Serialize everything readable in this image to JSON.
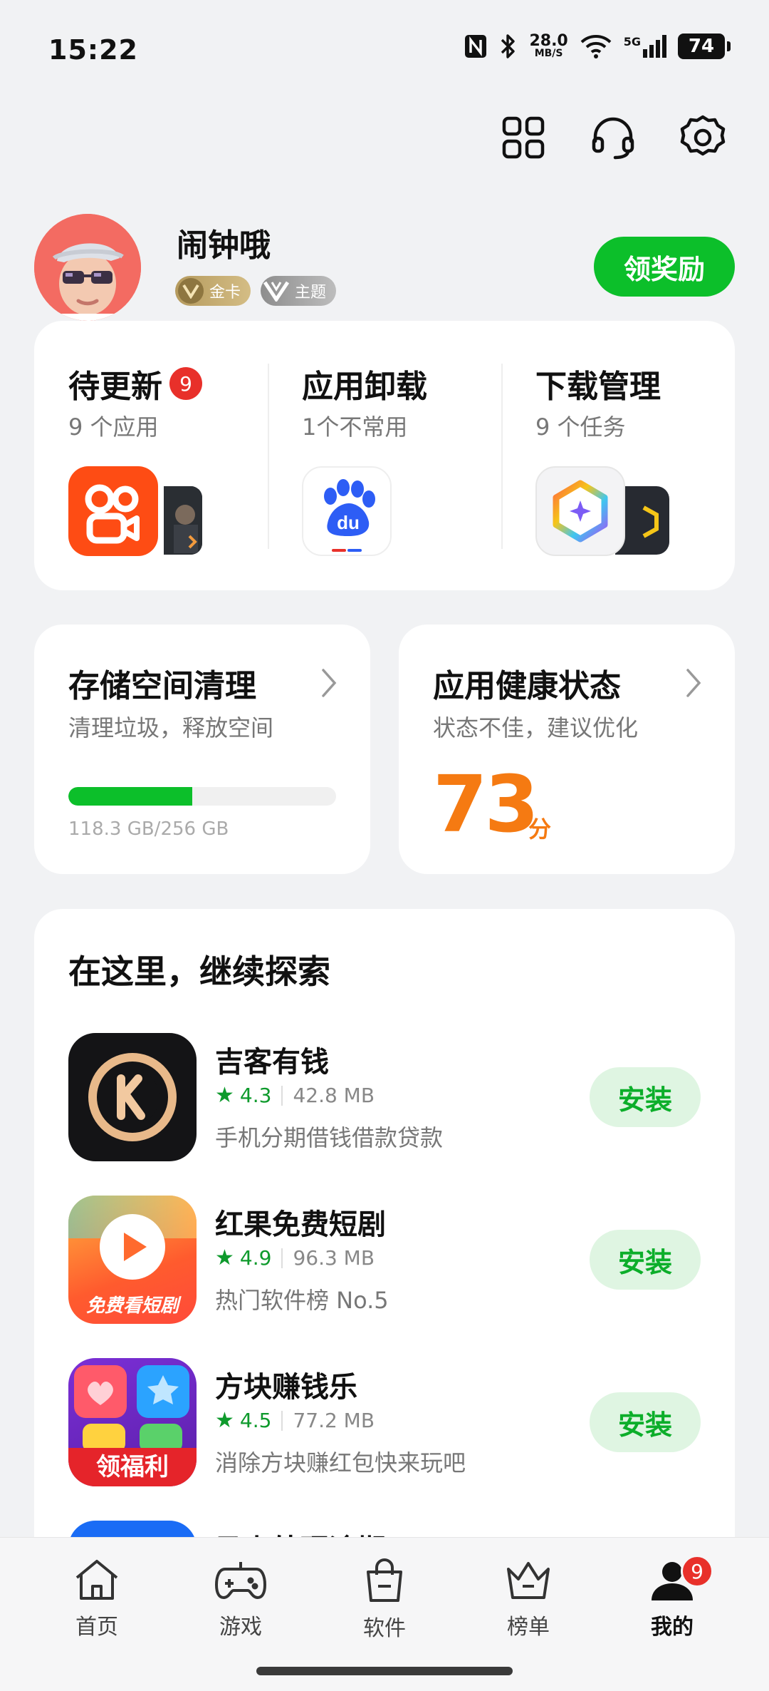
{
  "status_bar": {
    "time": "15:22",
    "net_speed": "28.0",
    "net_unit": "MB/S",
    "signal_label": "5G",
    "battery": "74",
    "icons": [
      "nfc-icon",
      "bluetooth-icon",
      "wifi-icon",
      "cell-signal-icon",
      "battery-icon"
    ]
  },
  "top_actions": [
    "apps-grid-icon",
    "headset-icon",
    "settings-gear-icon"
  ],
  "profile": {
    "name": "闹钟哦",
    "badge_gold": "金卡",
    "badge_theme": "主题",
    "reward_button": "领奖励"
  },
  "manage": {
    "updates": {
      "title": "待更新",
      "count": "9",
      "subtitle": "9 个应用"
    },
    "uninstall": {
      "title": "应用卸载",
      "subtitle": "1个不常用"
    },
    "downloads": {
      "title": "下载管理",
      "subtitle": "9 个任务"
    }
  },
  "storage": {
    "title": "存储空间清理",
    "subtitle": "清理垃圾，释放空间",
    "usage_text": "118.3 GB/256 GB",
    "used_fraction": 0.462
  },
  "health": {
    "title": "应用健康状态",
    "subtitle": "状态不佳，建议优化",
    "score": "73",
    "unit": "分"
  },
  "explore": {
    "title": "在这里，继续探索",
    "install_label": "安装",
    "items": [
      {
        "name": "吉客有钱",
        "rating": "4.3",
        "size": "42.8 MB",
        "desc": "手机分期借钱借款贷款"
      },
      {
        "name": "红果免费短剧",
        "rating": "4.9",
        "size": "96.3 MB",
        "desc": "热门软件榜 No.5",
        "icon_text": "免费看短剧"
      },
      {
        "name": "方块赚钱乐",
        "rating": "4.5",
        "size": "77.2 MB",
        "desc": "消除方块赚红包快来玩吧",
        "icon_text": "领福利"
      },
      {
        "name": "马上处理逾期"
      }
    ]
  },
  "bottom_nav": {
    "items": [
      {
        "label": "首页",
        "icon": "home-icon"
      },
      {
        "label": "游戏",
        "icon": "gamepad-icon"
      },
      {
        "label": "软件",
        "icon": "shopping-bag-icon"
      },
      {
        "label": "榜单",
        "icon": "crown-icon"
      },
      {
        "label": "我的",
        "icon": "person-icon",
        "badge": "9"
      }
    ],
    "active": "我的"
  },
  "colors": {
    "accent_green": "#0cbf2a",
    "badge_red": "#e8302a",
    "score_orange": "#f57a12"
  }
}
